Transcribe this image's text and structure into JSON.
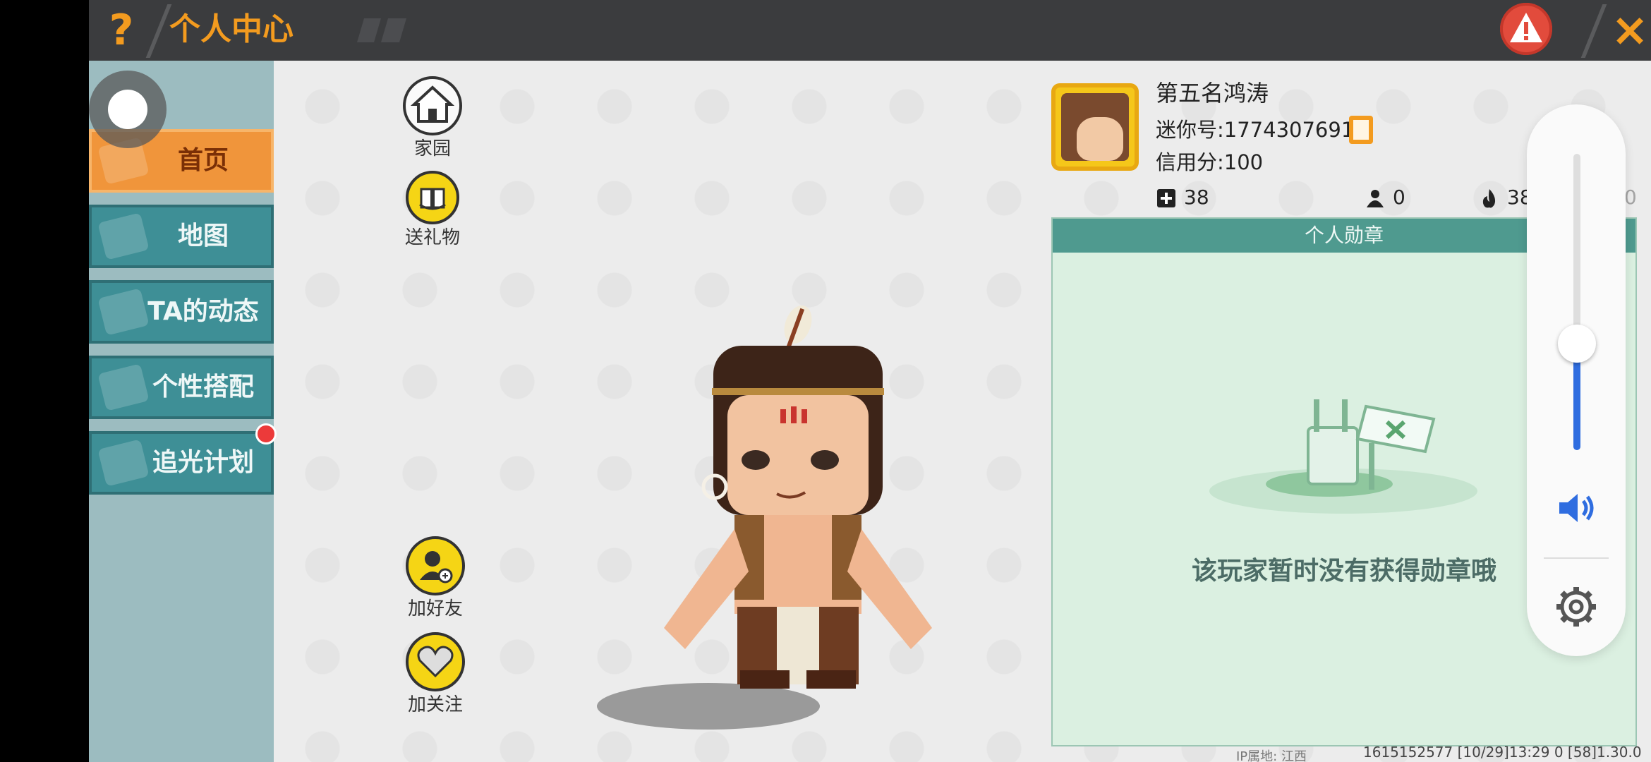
{
  "header": {
    "help_symbol": "?",
    "title": "个人中心",
    "close_symbol": "×"
  },
  "sidebar": {
    "items": [
      {
        "label": "首页",
        "active": true
      },
      {
        "label": "地图",
        "active": false
      },
      {
        "label": "TA的动态",
        "active": false
      },
      {
        "label": "个性搭配",
        "active": false
      },
      {
        "label": "追光计划",
        "active": false,
        "has_notification": true
      }
    ]
  },
  "actions": {
    "home": "家园",
    "gift": "送礼物",
    "add_friend": "加好友",
    "follow": "加关注"
  },
  "profile": {
    "name": "第五名鸿涛",
    "mini_id_label": "迷你号:",
    "mini_id": "1774307691",
    "credit_label": "信用分:",
    "credit": "100",
    "stats": {
      "stat1": "38",
      "stat2": "0",
      "stat3": "380",
      "stat4": "0"
    }
  },
  "medal_panel": {
    "title": "个人勋章",
    "empty_text": "该玩家暂时没有获得勋章哦"
  },
  "volume": {
    "level": 0.36
  },
  "footer": {
    "ip_location": "IP属地: 江西",
    "build_info": "1615152577  [10/29]13:29 0  [58]1.30.0"
  },
  "colors": {
    "accent": "#f39b1f",
    "nav_bg": "#3e8f96",
    "nav_active": "#f0953b",
    "panel_header": "#4f9a8f",
    "panel_bg": "#dbf0e1",
    "volume_fill": "#2f6de0",
    "warning": "#e24b3c"
  }
}
